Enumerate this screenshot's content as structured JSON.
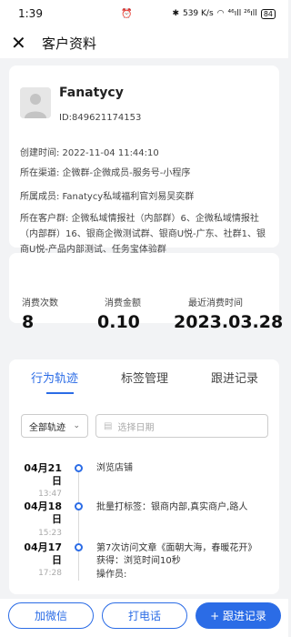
{
  "status_bar": {
    "time": "1:39",
    "net_speed": "539 K/s",
    "signal_text": "⁴⁶ıll ²⁶ıll",
    "battery": "84"
  },
  "header": {
    "title": "客户资料"
  },
  "profile": {
    "name": "Fanatycy",
    "id_text": "ID:849621174153",
    "created": "创建时间: 2022-11-04 11:44:10",
    "channel": "所在渠道: 企微群-企微成员-服务号-小程序",
    "member": "所属成员: Fanatycy私域福利官刘易吴奕群",
    "groups": "所在客户群: 企微私域情报社（内部群）6、企微私域情报社（内部群）16、银商企微测试群、银商U悦-广东、社群1、银商U悦-产品内部测试、任务宝体验群"
  },
  "stats": {
    "count_label": "消费次数",
    "count_value": "8",
    "amount_label": "消费金额",
    "amount_value": "0.10",
    "recent_label": "最近消费时间",
    "recent_value": "2023.03.28"
  },
  "tabs": [
    {
      "label": "行为轨迹"
    },
    {
      "label": "标签管理"
    },
    {
      "label": "跟进记录"
    }
  ],
  "filters": {
    "track_select": "全部轨迹",
    "date_placeholder": "选择日期"
  },
  "timeline": [
    {
      "date": "04月21日",
      "time": "13:47",
      "text": "浏览店铺"
    },
    {
      "date": "04月18日",
      "time": "15:23",
      "text": "批量打标签：银商内部,真实商户,路人"
    },
    {
      "date": "04月17日",
      "time": "17:28",
      "text": "第7次访问文章《面朝大海，春暖花开》获得：浏览时间10秒",
      "text2": "操作员:"
    }
  ],
  "actions": {
    "add_wechat": "加微信",
    "call": "打电话",
    "follow_up": "+ 跟进记录"
  },
  "colors": {
    "accent": "#2b6ce6",
    "background": "#f2f3f5"
  }
}
